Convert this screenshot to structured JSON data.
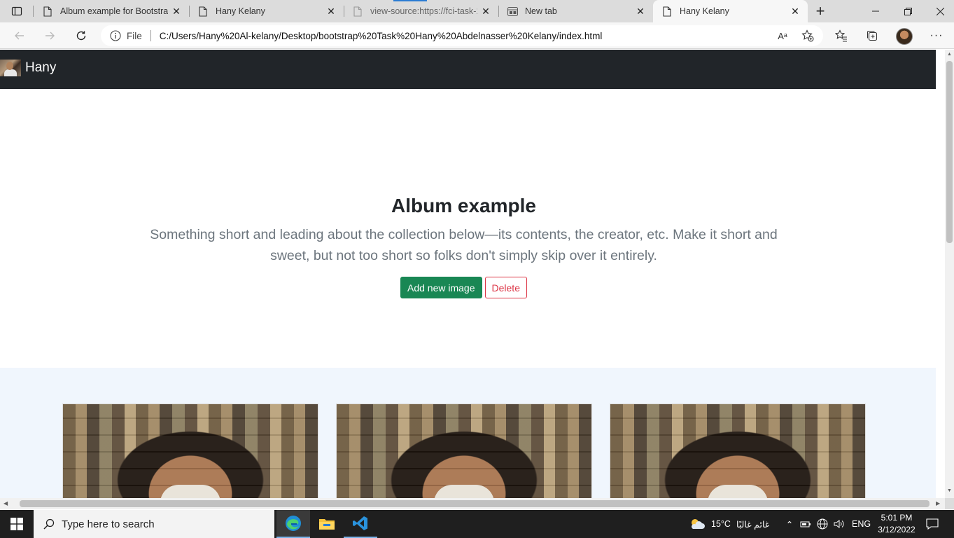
{
  "browser": {
    "tabs": [
      {
        "title": "Album example for Bootstrap",
        "icon": "page-icon",
        "active": false
      },
      {
        "title": "Hany Kelany",
        "icon": "page-icon",
        "active": false
      },
      {
        "title": "view-source:https://fci-task-1",
        "icon": "page-icon",
        "active": false
      },
      {
        "title": "New tab",
        "icon": "newtab-icon",
        "active": false
      },
      {
        "title": "Hany Kelany",
        "icon": "page-icon",
        "active": true
      }
    ],
    "address": {
      "scheme_label": "File",
      "url": "C:/Users/Hany%20Al-kelany/Desktop/bootstrap%20Task%20Hany%20Abdelnasser%20Kelany/index.html",
      "read_aloud": "Aᵃ"
    }
  },
  "page": {
    "brand": {
      "name": "Hany"
    },
    "hero": {
      "title": "Album example",
      "lead": "Something short and leading about the collection below—its contents, the creator, etc. Make it short and sweet, but not too short so folks don't simply skip over it entirely.",
      "primary_button": "Add new image",
      "secondary_button": "Delete"
    },
    "cards_count": 3
  },
  "taskbar": {
    "search_placeholder": "Type here to search",
    "weather": {
      "temp": "15°C",
      "condition": "غائم غالبًا"
    },
    "language": "ENG",
    "time": "5:01 PM",
    "date": "3/12/2022"
  },
  "colors": {
    "navbar_bg": "#212529",
    "success": "#198754",
    "danger": "#dc3545",
    "album_bg": "#f0f6fd"
  }
}
